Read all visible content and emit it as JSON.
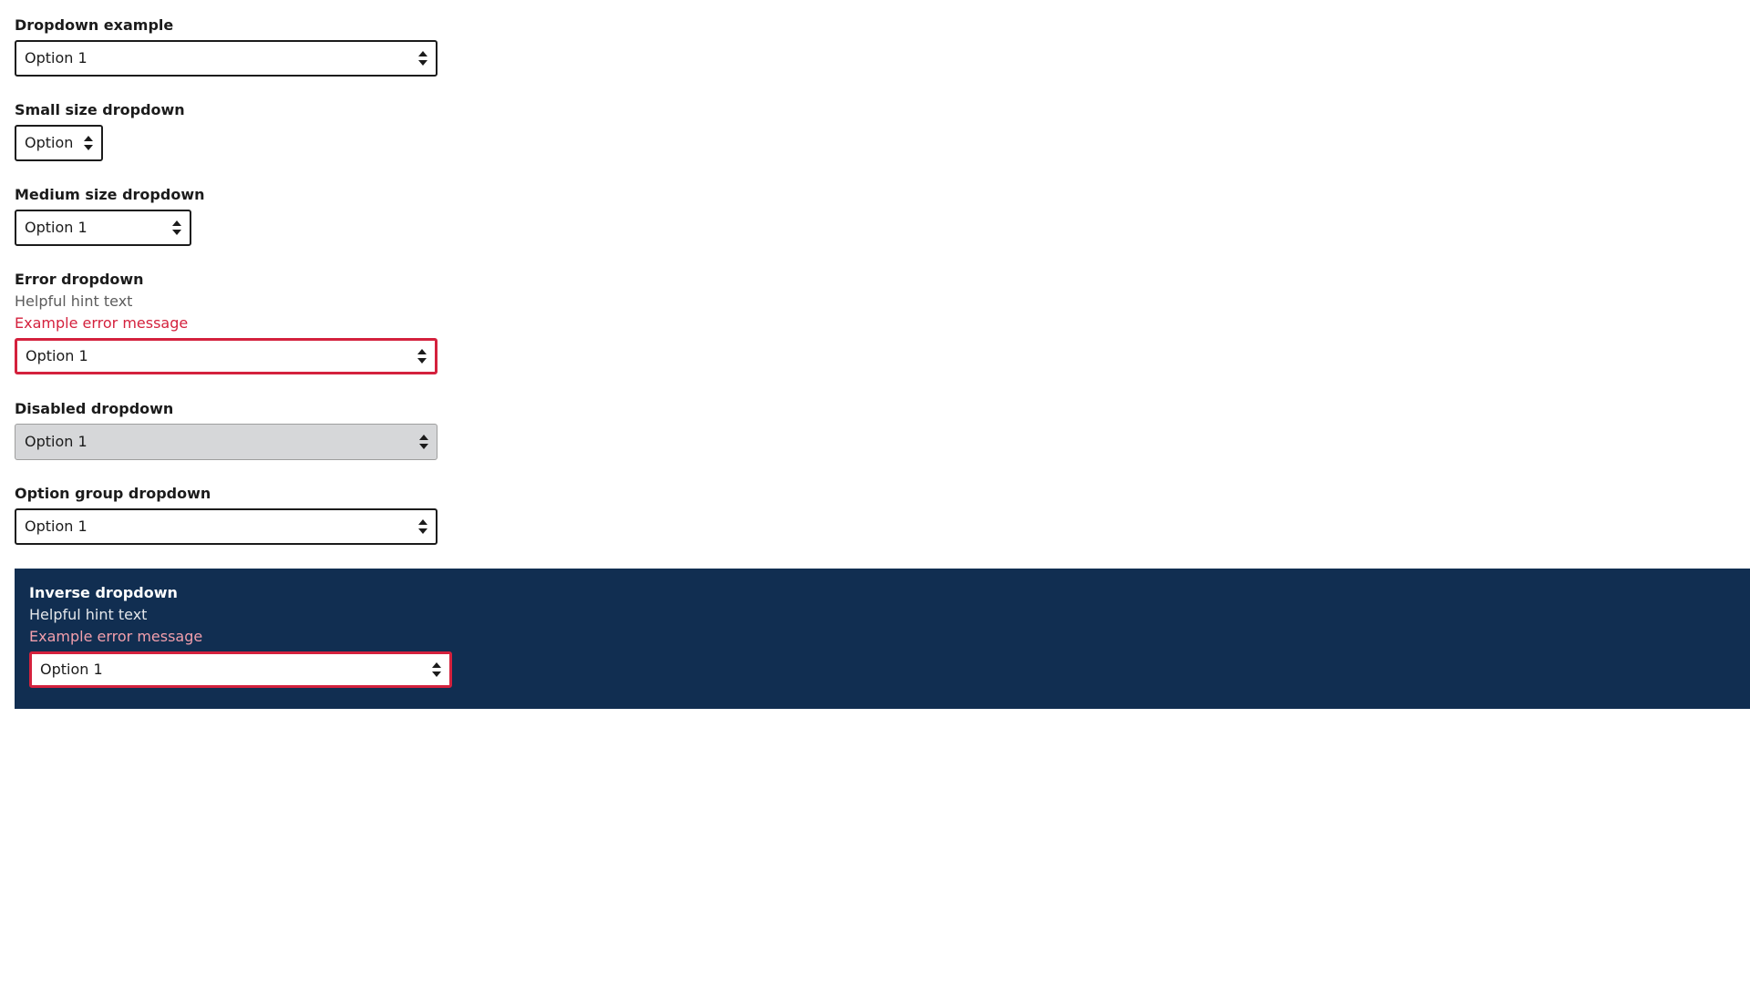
{
  "colors": {
    "error": "#d4213d",
    "inverse_background": "#112e51",
    "disabled_background": "#d6d7d9"
  },
  "dropdowns": {
    "example": {
      "label": "Dropdown example",
      "value": "Option 1"
    },
    "small": {
      "label": "Small size dropdown",
      "value": "Option"
    },
    "medium": {
      "label": "Medium size dropdown",
      "value": "Option 1"
    },
    "error": {
      "label": "Error dropdown",
      "hint": "Helpful hint text",
      "error_message": "Example error message",
      "value": "Option 1"
    },
    "disabled": {
      "label": "Disabled dropdown",
      "value": "Option 1"
    },
    "option_group": {
      "label": "Option group dropdown",
      "value": "Option 1"
    },
    "inverse": {
      "label": "Inverse dropdown",
      "hint": "Helpful hint text",
      "error_message": "Example error message",
      "value": "Option 1"
    }
  },
  "icons": {
    "select_caret": "up-down-caret-icon"
  }
}
